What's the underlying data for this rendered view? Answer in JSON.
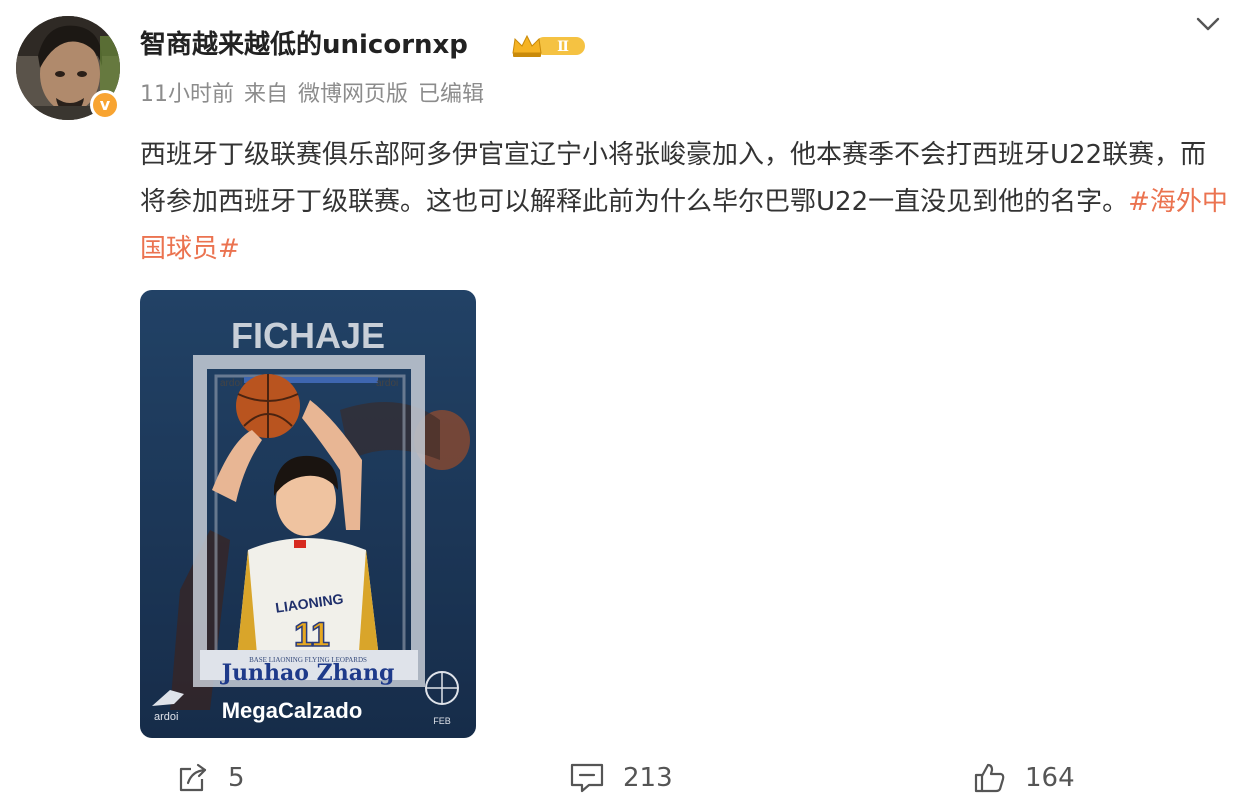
{
  "post": {
    "author": {
      "name": "智商越来越低的unicornxp",
      "vip_level": "Ⅱ",
      "verified_mark": "v"
    },
    "meta": {
      "time": "11小时前",
      "source_prefix": "来自",
      "source": "微博网页版",
      "edited": "已编辑"
    },
    "text": "西班牙丁级联赛俱乐部阿多伊官宣辽宁小将张峻豪加入，他本赛季不会打西班牙U22联赛，而将参加西班牙丁级联赛。这也可以解释此前为什么毕尔巴鄂U22一直没见到他的名字。",
    "hashtag": "#海外中国球员#",
    "image": {
      "headline": "FICHAJE",
      "team_line": "BASE    LIAONING FLYING LEOPARDS",
      "player_name": "Junhao Zhang",
      "sponsor": "MegaCalzado",
      "jersey_number": "11",
      "jersey_text": "LIAONING",
      "brand": "ardoi",
      "league_mark": "FEB"
    },
    "actions": {
      "forward_count": "5",
      "comment_count": "213",
      "like_count": "164"
    }
  },
  "icons": {
    "more": "chevron-down-icon",
    "forward": "share-icon",
    "comment": "comment-icon",
    "like": "thumbs-up-icon",
    "vip": "crown-icon",
    "verified": "verified-badge-icon"
  },
  "colors": {
    "hashtag": "#eb7350",
    "meta_text": "#8c8c8c",
    "verified_badge": "#f8a431",
    "vip_badge": "#f5c242",
    "card_background": "#1e3c5e"
  }
}
